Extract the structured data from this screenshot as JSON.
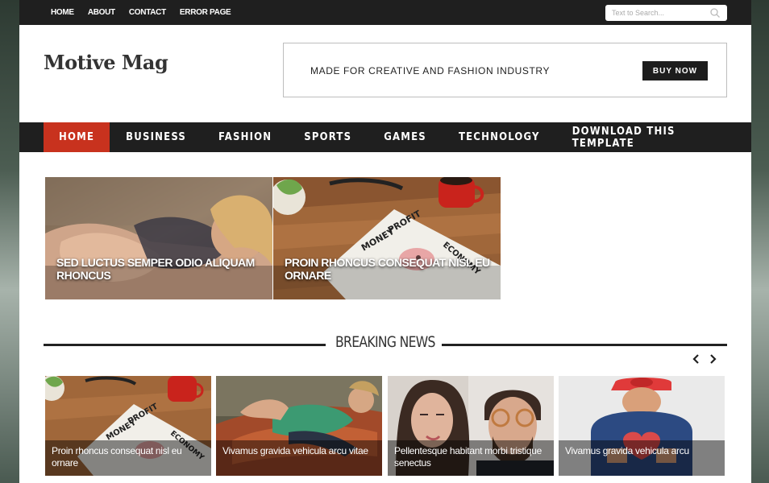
{
  "topbar": {
    "links": [
      "HOME",
      "ABOUT",
      "CONTACT",
      "ERROR PAGE"
    ],
    "search_placeholder": "Text to Search..."
  },
  "header": {
    "logo": "Motive Mag",
    "banner_text": "MADE FOR CREATIVE AND FASHION INDUSTRY",
    "banner_button": "BUY NOW"
  },
  "mainnav": {
    "items": [
      "HOME",
      "BUSINESS",
      "FASHION",
      "SPORTS",
      "GAMES",
      "TECHNOLOGY",
      "DOWNLOAD THIS TEMPLATE"
    ],
    "active": "HOME",
    "accent": "#c8321e"
  },
  "featured": [
    {
      "title": "SED LUCTUS SEMPER ODIO ALIQUAM RHONCUS"
    },
    {
      "title": "PROIN RHONCUS CONSEQUAT NISL EU ORNARE"
    }
  ],
  "breaking": {
    "title": "BREAKING NEWS",
    "prev_icon": "chevron-left-icon",
    "next_icon": "chevron-right-icon",
    "cards": [
      {
        "title": "Proin rhoncus consequat nisl eu ornare"
      },
      {
        "title": "Vivamus gravida vehicula arcu vitae"
      },
      {
        "title": "Pellentesque habitant morbi tristique senectus"
      },
      {
        "title": "Vivamus gravida vehicula arcu"
      }
    ]
  }
}
